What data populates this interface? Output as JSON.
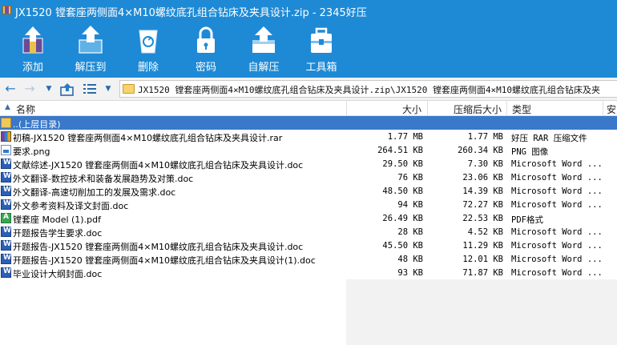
{
  "window": {
    "title": "JX1520 镗套座两侧面4×M10螺纹底孔组合钻床及夹具设计.zip - 2345好压"
  },
  "toolbar": {
    "buttons": [
      {
        "label": "添加",
        "icon": "add-archive-icon"
      },
      {
        "label": "解压到",
        "icon": "extract-to-icon"
      },
      {
        "label": "删除",
        "icon": "recycle-bin-icon"
      },
      {
        "label": "密码",
        "icon": "padlock-icon"
      },
      {
        "label": "自解压",
        "icon": "self-extract-icon"
      },
      {
        "label": "工具箱",
        "icon": "toolbox-icon"
      }
    ]
  },
  "address": {
    "path": "JX1520 镗套座两侧面4×M10螺纹底孔组合钻床及夹具设计.zip\\JX1520 镗套座两侧面4×M10螺纹底孔组合钻床及夹"
  },
  "columns": {
    "name": "名称",
    "size": "大小",
    "compressed": "压缩后大小",
    "type": "类型",
    "modified": "安"
  },
  "files": [
    {
      "name": "..(上层目录)",
      "size": "",
      "compressed": "",
      "type": "",
      "icon": "folder-up-icon",
      "selected": true
    },
    {
      "name": "初稿-JX1520 镗套座两侧面4×M10螺纹底孔组合钻床及夹具设计.rar",
      "size": "1.77 MB",
      "compressed": "1.77 MB",
      "type": "好压 RAR 压缩文件",
      "icon": "rar-icon"
    },
    {
      "name": "要求.png",
      "size": "264.51 KB",
      "compressed": "260.34 KB",
      "type": "PNG 图像",
      "icon": "png-icon"
    },
    {
      "name": "文献综述-JX1520 镗套座两侧面4×M10螺纹底孔组合钻床及夹具设计.doc",
      "size": "29.50 KB",
      "compressed": "7.30 KB",
      "type": "Microsoft Word ...",
      "icon": "word-doc-icon"
    },
    {
      "name": "外文翻译-数控技术和装备发展趋势及对策.doc",
      "size": "76 KB",
      "compressed": "23.06 KB",
      "type": "Microsoft Word ...",
      "icon": "word-doc-icon"
    },
    {
      "name": "外文翻译-高速切削加工的发展及需求.doc",
      "size": "48.50 KB",
      "compressed": "14.39 KB",
      "type": "Microsoft Word ...",
      "icon": "word-doc-icon"
    },
    {
      "name": "外文参考资料及译文封面.doc",
      "size": "94 KB",
      "compressed": "72.27 KB",
      "type": "Microsoft Word ...",
      "icon": "word-doc-icon"
    },
    {
      "name": "镗套座 Model (1).pdf",
      "size": "26.49 KB",
      "compressed": "22.53 KB",
      "type": "PDF格式",
      "icon": "pdf-icon"
    },
    {
      "name": "开题报告学生要求.doc",
      "size": "28 KB",
      "compressed": "4.52 KB",
      "type": "Microsoft Word ...",
      "icon": "word-doc-icon"
    },
    {
      "name": "开题报告-JX1520 镗套座两侧面4×M10螺纹底孔组合钻床及夹具设计.doc",
      "size": "45.50 KB",
      "compressed": "11.29 KB",
      "type": "Microsoft Word ...",
      "icon": "word-doc-icon"
    },
    {
      "name": "开题报告-JX1520 镗套座两侧面4×M10螺纹底孔组合钻床及夹具设计(1).doc",
      "size": "48 KB",
      "compressed": "12.01 KB",
      "type": "Microsoft Word ...",
      "icon": "word-doc-icon"
    },
    {
      "name": "毕业设计大纲封面.doc",
      "size": "93 KB",
      "compressed": "71.87 KB",
      "type": "Microsoft Word ...",
      "icon": "word-doc-icon"
    }
  ],
  "colors": {
    "accent": "#1e8ad6",
    "selection": "#3a78c9"
  }
}
